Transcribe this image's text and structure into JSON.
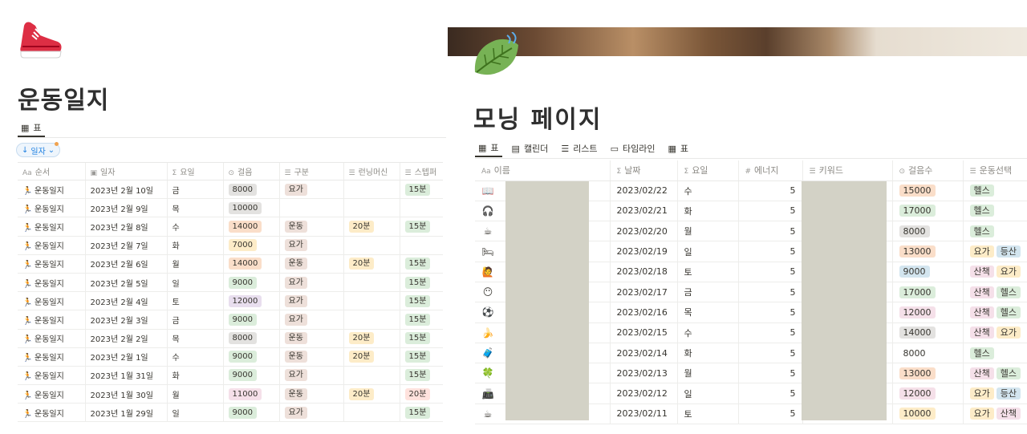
{
  "left": {
    "title": "운동일지",
    "view_tab": "표",
    "sort_chip": "일자",
    "columns": [
      "순서",
      "일자",
      "요일",
      "걸음",
      "구분",
      "런닝머신",
      "스텝퍼"
    ],
    "column_prefixes": {
      "name": "Aa",
      "formula": "Σ"
    },
    "rows": [
      {
        "name": "운동일지",
        "date": "2023년 2월 10일",
        "day": "금",
        "steps": "8000",
        "steps_color": "#e3e2e0",
        "type": "요가",
        "run": "",
        "stepper": "15분",
        "stepper_color": "#dbeddb"
      },
      {
        "name": "운동일지",
        "date": "2023년 2월 9일",
        "day": "목",
        "steps": "10000",
        "steps_color": "#e3e2e0",
        "type": "",
        "run": "",
        "stepper": "",
        "stepper_color": ""
      },
      {
        "name": "운동일지",
        "date": "2023년 2월 8일",
        "day": "수",
        "steps": "14000",
        "steps_color": "#fadec9",
        "type": "운동",
        "run": "20분",
        "stepper": "15분",
        "stepper_color": "#dbeddb"
      },
      {
        "name": "운동일지",
        "date": "2023년 2월 7일",
        "day": "화",
        "steps": "7000",
        "steps_color": "#fdecc8",
        "type": "요가",
        "run": "",
        "stepper": "",
        "stepper_color": ""
      },
      {
        "name": "운동일지",
        "date": "2023년 2월 6일",
        "day": "월",
        "steps": "14000",
        "steps_color": "#fadec9",
        "type": "운동",
        "run": "20분",
        "stepper": "15분",
        "stepper_color": "#dbeddb"
      },
      {
        "name": "운동일지",
        "date": "2023년 2월 5일",
        "day": "일",
        "steps": "9000",
        "steps_color": "#dbeddb",
        "type": "요가",
        "run": "",
        "stepper": "15분",
        "stepper_color": "#dbeddb"
      },
      {
        "name": "운동일지",
        "date": "2023년 2월 4일",
        "day": "토",
        "steps": "12000",
        "steps_color": "#e8deee",
        "type": "요가",
        "run": "",
        "stepper": "15분",
        "stepper_color": "#dbeddb"
      },
      {
        "name": "운동일지",
        "date": "2023년 2월 3일",
        "day": "금",
        "steps": "9000",
        "steps_color": "#dbeddb",
        "type": "요가",
        "run": "",
        "stepper": "15분",
        "stepper_color": "#dbeddb"
      },
      {
        "name": "운동일지",
        "date": "2023년 2월 2일",
        "day": "목",
        "steps": "8000",
        "steps_color": "#e3e2e0",
        "type": "운동",
        "run": "20분",
        "stepper": "15분",
        "stepper_color": "#dbeddb"
      },
      {
        "name": "운동일지",
        "date": "2023년 2월 1일",
        "day": "수",
        "steps": "9000",
        "steps_color": "#dbeddb",
        "type": "운동",
        "run": "20분",
        "stepper": "15분",
        "stepper_color": "#dbeddb"
      },
      {
        "name": "운동일지",
        "date": "2023년 1월 31일",
        "day": "화",
        "steps": "9000",
        "steps_color": "#dbeddb",
        "type": "요가",
        "run": "",
        "stepper": "15분",
        "stepper_color": "#dbeddb"
      },
      {
        "name": "운동일지",
        "date": "2023년 1월 30일",
        "day": "월",
        "steps": "11000",
        "steps_color": "#f5e0e9",
        "type": "운동",
        "run": "20분",
        "stepper": "20분",
        "stepper_color": "#ffe2dd"
      },
      {
        "name": "운동일지",
        "date": "2023년 1월 29일",
        "day": "일",
        "steps": "9000",
        "steps_color": "#dbeddb",
        "type": "요가",
        "run": "",
        "stepper": "15분",
        "stepper_color": "#dbeddb"
      }
    ]
  },
  "right": {
    "title": "모닝 페이지",
    "view_tabs": [
      "표",
      "캘린더",
      "리스트",
      "타임라인",
      "표"
    ],
    "columns": [
      "이름",
      "날짜",
      "요일",
      "에너지",
      "키워드",
      "걸음수",
      "운동선택"
    ],
    "column_prefixes": {
      "name": "Aa",
      "formula": "Σ",
      "number": "#"
    },
    "rows": [
      {
        "icon": "book-icon",
        "glyph": "📖",
        "date": "2023/02/22",
        "day": "수",
        "energy": "5",
        "steps": "15000",
        "steps_color": "#fadec9",
        "ex": [
          {
            "t": "헬스",
            "c": "#dbeddb"
          }
        ]
      },
      {
        "icon": "headphones-icon",
        "glyph": "🎧",
        "date": "2023/02/21",
        "day": "화",
        "energy": "5",
        "steps": "17000",
        "steps_color": "#dbeddb",
        "ex": [
          {
            "t": "헬스",
            "c": "#dbeddb"
          }
        ]
      },
      {
        "icon": "coffee-icon",
        "glyph": "☕",
        "date": "2023/02/20",
        "day": "월",
        "energy": "5",
        "steps": "8000",
        "steps_color": "#e3e2e0",
        "ex": [
          {
            "t": "헬스",
            "c": "#dbeddb"
          }
        ]
      },
      {
        "icon": "bed-icon",
        "glyph": "🛏",
        "date": "2023/02/19",
        "day": "일",
        "energy": "5",
        "steps": "13000",
        "steps_color": "#fadec9",
        "ex": [
          {
            "t": "요가",
            "c": "#fdecc8"
          },
          {
            "t": "등산",
            "c": "#d3e5ef"
          }
        ]
      },
      {
        "icon": "person-icon",
        "glyph": "🙋",
        "date": "2023/02/18",
        "day": "토",
        "energy": "5",
        "steps": "9000",
        "steps_color": "#d3e5ef",
        "ex": [
          {
            "t": "산책",
            "c": "#f5e0e9"
          },
          {
            "t": "요가",
            "c": "#fdecc8"
          }
        ]
      },
      {
        "icon": "face-icon",
        "glyph": "😶",
        "date": "2023/02/17",
        "day": "금",
        "energy": "5",
        "steps": "17000",
        "steps_color": "#dbeddb",
        "ex": [
          {
            "t": "산책",
            "c": "#f5e0e9"
          },
          {
            "t": "헬스",
            "c": "#dbeddb"
          }
        ]
      },
      {
        "icon": "soccer-ball-icon",
        "glyph": "⚽",
        "date": "2023/02/16",
        "day": "목",
        "energy": "5",
        "steps": "12000",
        "steps_color": "#f5e0e9",
        "ex": [
          {
            "t": "산책",
            "c": "#f5e0e9"
          },
          {
            "t": "헬스",
            "c": "#dbeddb"
          }
        ]
      },
      {
        "icon": "banana-icon",
        "glyph": "🍌",
        "date": "2023/02/15",
        "day": "수",
        "energy": "5",
        "steps": "14000",
        "steps_color": "#e3e2e0",
        "ex": [
          {
            "t": "산책",
            "c": "#f5e0e9"
          },
          {
            "t": "요가",
            "c": "#fdecc8"
          }
        ]
      },
      {
        "icon": "luggage-icon",
        "glyph": "🧳",
        "date": "2023/02/14",
        "day": "화",
        "energy": "5",
        "steps": "8000",
        "steps_color": "#ffffff",
        "ex": [
          {
            "t": "헬스",
            "c": "#dbeddb"
          }
        ]
      },
      {
        "icon": "clover-icon",
        "glyph": "🍀",
        "date": "2023/02/13",
        "day": "월",
        "energy": "5",
        "steps": "13000",
        "steps_color": "#fadec9",
        "ex": [
          {
            "t": "산책",
            "c": "#f5e0e9"
          },
          {
            "t": "헬스",
            "c": "#dbeddb"
          }
        ]
      },
      {
        "icon": "printer-icon",
        "glyph": "📠",
        "date": "2023/02/12",
        "day": "일",
        "energy": "5",
        "steps": "12000",
        "steps_color": "#f5e0e9",
        "ex": [
          {
            "t": "요가",
            "c": "#fdecc8"
          },
          {
            "t": "등산",
            "c": "#d3e5ef"
          }
        ]
      },
      {
        "icon": "coffee-icon",
        "glyph": "☕",
        "date": "2023/02/11",
        "day": "토",
        "energy": "5",
        "steps": "10000",
        "steps_color": "#fdecc8",
        "ex": [
          {
            "t": "요가",
            "c": "#fdecc8"
          },
          {
            "t": "산책",
            "c": "#f5e0e9"
          }
        ]
      }
    ]
  }
}
